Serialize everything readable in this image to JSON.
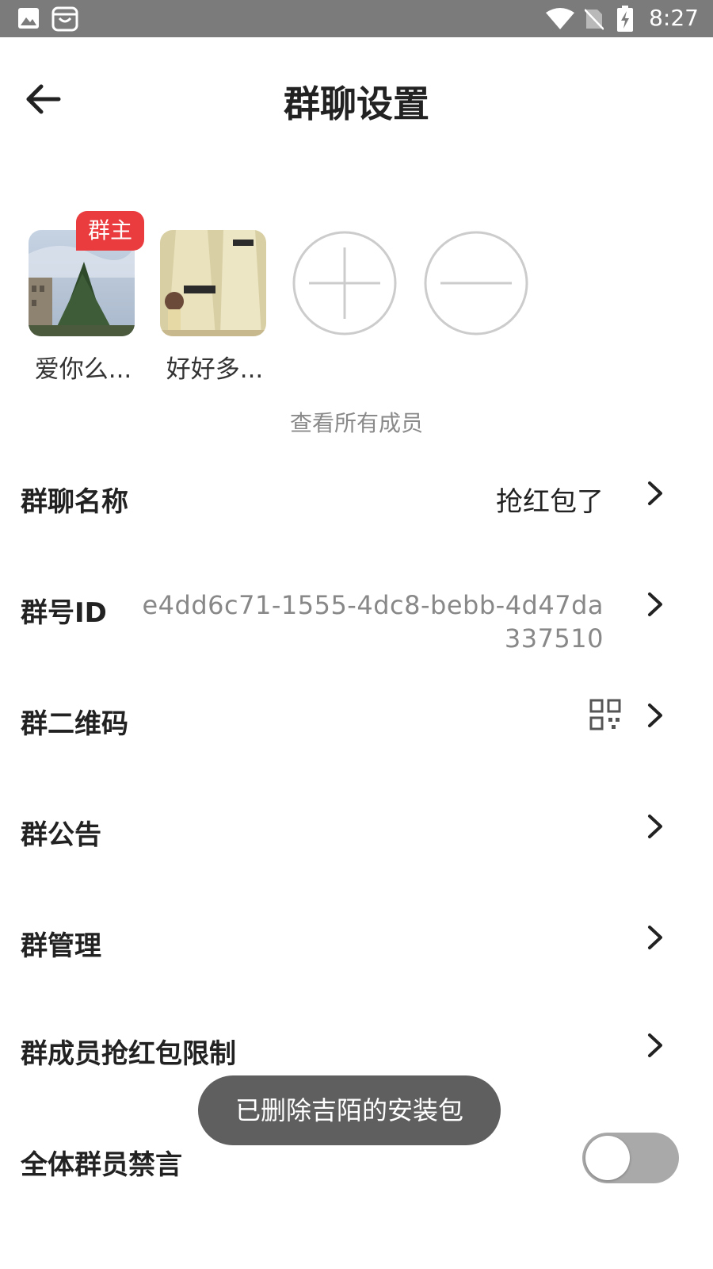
{
  "status_bar": {
    "time": "8:27",
    "icons": [
      "image-icon",
      "shopping-bag-icon",
      "wifi-icon",
      "no-sim-icon",
      "battery-charging-icon"
    ]
  },
  "header": {
    "title": "群聊设置",
    "back_icon": "arrow-left-icon"
  },
  "members": {
    "owner_badge": "群主",
    "items": [
      {
        "name": "爱你么..."
      },
      {
        "name": "好好多..."
      }
    ],
    "add_icon": "plus-circle-icon",
    "remove_icon": "minus-circle-icon",
    "view_all": "查看所有成员"
  },
  "settings": {
    "group_name": {
      "label": "群聊名称",
      "value": "抢红包了"
    },
    "group_id": {
      "label": "群号ID",
      "value": "e4dd6c71-1555-4dc8-bebb-4d47da337510"
    },
    "qr_code": {
      "label": "群二维码",
      "icon": "qr-code-icon"
    },
    "announcement": {
      "label": "群公告"
    },
    "management": {
      "label": "群管理"
    },
    "red_packet_limit": {
      "label": "群成员抢红包限制"
    },
    "mute_all": {
      "label": "全体群员禁言",
      "enabled": false
    }
  },
  "toast": "已删除吉陌的安装包",
  "colors": {
    "status_bar": "#7b7b7b",
    "badge_red": "#ea3b3e",
    "toast_bg": "#5f5f5f",
    "toggle_off": "#a9a9a9"
  }
}
